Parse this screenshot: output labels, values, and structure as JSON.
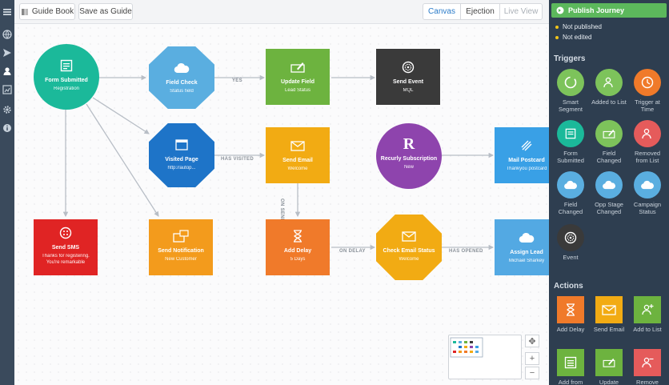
{
  "toolbar": {
    "guide_book": "Guide Book",
    "save_as_guide": "Save as Guide",
    "tabs": [
      "Canvas",
      "Ejection",
      "Live View"
    ]
  },
  "left_nav": {
    "icons": [
      "menu-icon",
      "globe-icon",
      "send-icon",
      "user-icon",
      "chart-icon",
      "gear-icon",
      "info-icon"
    ]
  },
  "nodes": {
    "form_submitted": {
      "title": "Form Submitted",
      "sub": "Registration",
      "color": "#1bb99a"
    },
    "field_check": {
      "title": "Field Check",
      "sub": "Status field",
      "color": "#5aaee0"
    },
    "update_field": {
      "title": "Update Field",
      "sub": "Lead Status",
      "color": "#6db33f"
    },
    "send_event": {
      "title": "Send Event",
      "sub": "MQL",
      "color": "#3a3a3a"
    },
    "visited_page": {
      "title": "Visited Page",
      "sub": "http://autop...",
      "color": "#1e74c8"
    },
    "send_email": {
      "title": "Send Email",
      "sub": "Welcome",
      "color": "#f2ab13"
    },
    "recurly": {
      "title": "Recurly Subscription",
      "sub": "New",
      "color": "#8e44ad"
    },
    "mail_postcard": {
      "title": "Mail Postcard",
      "sub": "Thankyou postcard",
      "color": "#39a0e6"
    },
    "send_sms": {
      "title": "Send SMS",
      "sub": "Thanks for registering. You're remarkable",
      "color": "#e02424"
    },
    "send_notification": {
      "title": "Send Notification",
      "sub": "New Customer",
      "color": "#f39b1c"
    },
    "add_delay": {
      "title": "Add Delay",
      "sub": "5 Days",
      "color": "#f07a2a"
    },
    "check_email_status": {
      "title": "Check Email Status",
      "sub": "Welcome",
      "color": "#f2ab13"
    },
    "assign_lead": {
      "title": "Assign Lead",
      "sub": "Michael Sharkey",
      "color": "#53a9e3"
    }
  },
  "edge_labels": {
    "yes": "YES",
    "has_visited": "HAS VISITED",
    "on_send": "ON SEND",
    "on_delay": "ON DELAY",
    "has_opened": "HAS OPENED"
  },
  "panel": {
    "publish_label": "Publish Journey",
    "statuses": [
      "Not published",
      "Not edited"
    ],
    "triggers_title": "Triggers",
    "triggers": [
      {
        "label": "Smart Segment",
        "icon": "segment-icon",
        "color": "#7dc35b",
        "shape": "circle"
      },
      {
        "label": "Added to List",
        "icon": "user-add-icon",
        "color": "#7dc35b",
        "shape": "circle"
      },
      {
        "label": "Trigger at Time",
        "icon": "clock-icon",
        "color": "#f07a2a",
        "shape": "circle"
      },
      {
        "label": "Form Submitted",
        "icon": "form-icon",
        "color": "#1bb99a",
        "shape": "circle"
      },
      {
        "label": "Field Changed",
        "icon": "edit-icon",
        "color": "#7dc35b",
        "shape": "circle"
      },
      {
        "label": "Removed from List",
        "icon": "user-remove-icon",
        "color": "#e55b5b",
        "shape": "circle"
      },
      {
        "label": "Field Changed",
        "icon": "cloud-icon",
        "color": "#5aaee0",
        "shape": "circle"
      },
      {
        "label": "Opp Stage Changed",
        "icon": "cloud-icon",
        "color": "#5aaee0",
        "shape": "circle"
      },
      {
        "label": "Campaign Status",
        "icon": "cloud-icon",
        "color": "#5aaee0",
        "shape": "circle"
      },
      {
        "label": "Event",
        "icon": "event-icon",
        "color": "#3a3a3a",
        "shape": "circle"
      }
    ],
    "actions_title": "Actions",
    "actions": [
      {
        "label": "Add Delay",
        "icon": "hourglass-icon",
        "color": "#f07a2a"
      },
      {
        "label": "Send Email",
        "icon": "mail-icon",
        "color": "#f2ab13"
      },
      {
        "label": "Add to List",
        "icon": "user-add-icon",
        "color": "#6db33f"
      },
      {
        "label": "Add from List",
        "icon": "list-icon",
        "color": "#6db33f"
      },
      {
        "label": "Update",
        "icon": "edit-icon",
        "color": "#6db33f"
      },
      {
        "label": "Remove",
        "icon": "user-remove-icon",
        "color": "#e55b5b"
      }
    ]
  }
}
